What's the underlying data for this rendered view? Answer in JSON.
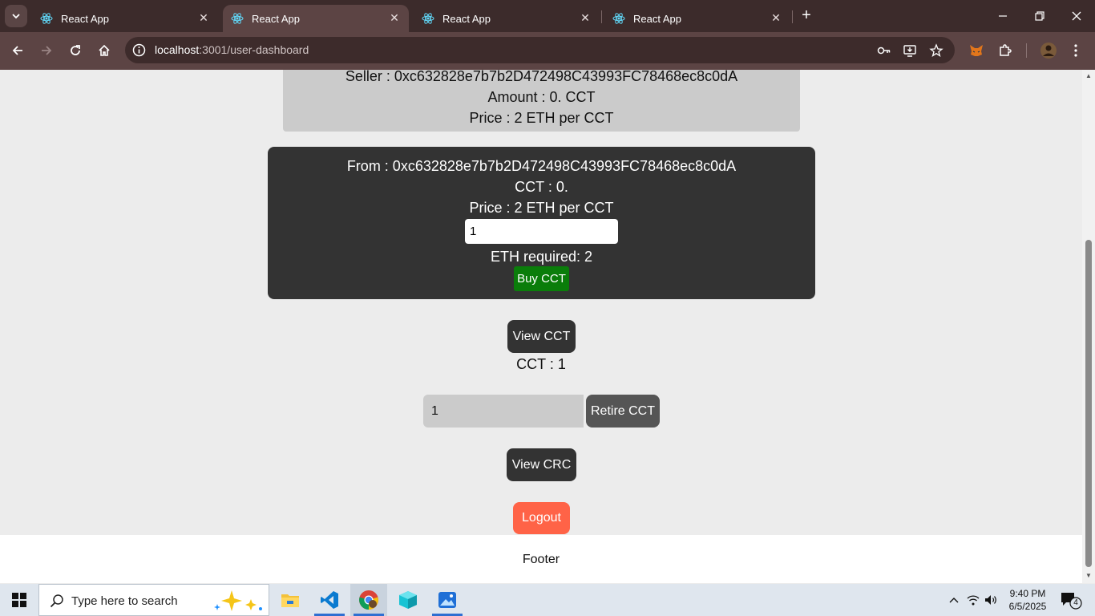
{
  "browser": {
    "tabs": [
      {
        "title": "React App",
        "active": false
      },
      {
        "title": "React App",
        "active": true
      },
      {
        "title": "React App",
        "active": false
      },
      {
        "title": "React App",
        "active": false
      }
    ],
    "url_host": "localhost",
    "url_path": ":3001/user-dashboard"
  },
  "listing": {
    "seller": "Seller : 0xc632828e7b7b2D472498C43993FC78468ec8c0dA",
    "amount": "Amount : 0. CCT",
    "price": "Price : 2 ETH per CCT"
  },
  "buy_card": {
    "from": "From : 0xc632828e7b7b2D472498C43993FC78468ec8c0dA",
    "cct": "CCT : 0.",
    "price": "Price : 2 ETH per CCT",
    "quantity_value": "1",
    "eth_required": "ETH required: 2",
    "buy_label": "Buy CCT"
  },
  "view_cct_label": "View CCT",
  "cct_balance": "CCT : 1",
  "retire": {
    "value": "1",
    "button_label": "Retire CCT"
  },
  "view_crc_label": "View CRC",
  "logout_label": "Logout",
  "footer_text": "Footer",
  "taskbar": {
    "search_placeholder": "Type here to search",
    "time": "9:40 PM",
    "date": "6/5/2025",
    "notification_count": "4"
  },
  "colors": {
    "buy_button": "#0a7d0a",
    "logout_button": "#ff6347",
    "dark_card": "#333333"
  }
}
